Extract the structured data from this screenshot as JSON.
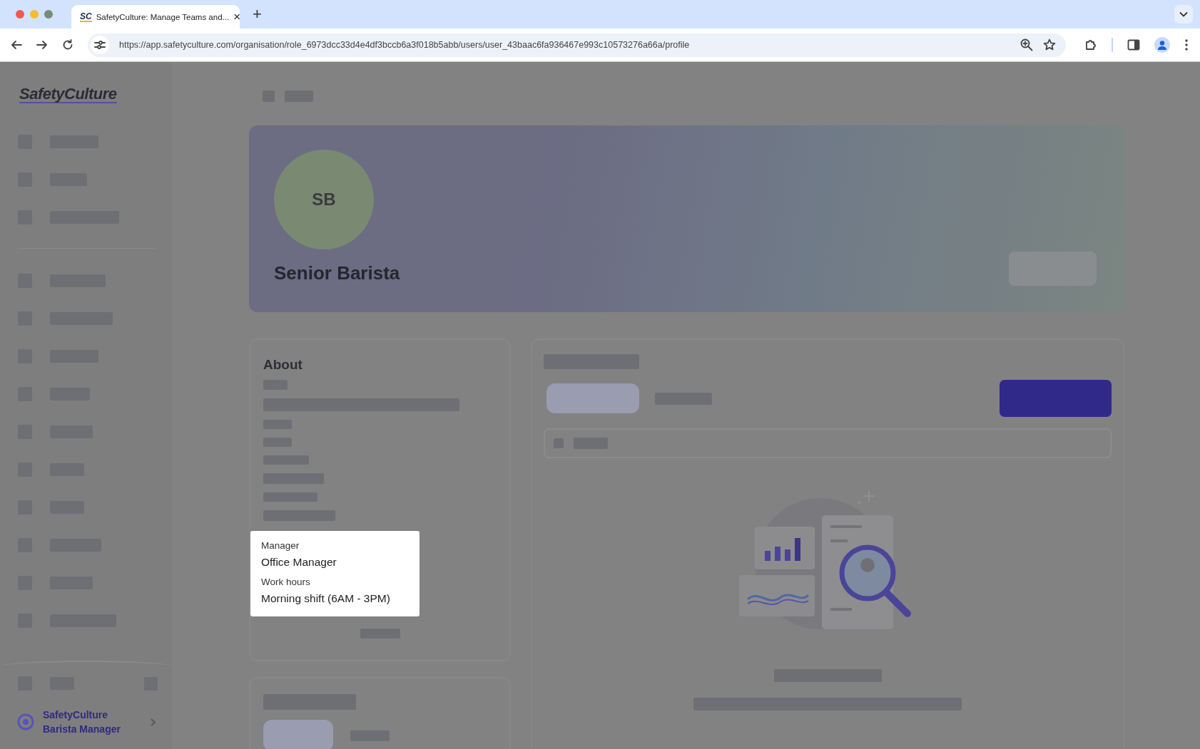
{
  "browser": {
    "tab": {
      "favicon": "SC",
      "title": "SafetyCulture: Manage Teams and...",
      "close": "×"
    },
    "new_tab": "+",
    "url": "https://app.safetyculture.com/organisation/role_6973dcc33d4e4df3bccb6a3f018b5abb/users/user_43baac6fa936467e993c10573276a66a/profile"
  },
  "sidebar": {
    "logo": "SafetyCulture",
    "organization": {
      "line_1": "SafetyCulture",
      "line_2": "Barista Manager"
    }
  },
  "profile": {
    "initials": "SB",
    "title": "Senior Barista"
  },
  "about": {
    "heading": "About",
    "tooltip": [
      {
        "kind": "label",
        "text": "Manager"
      },
      {
        "kind": "value",
        "text": "Office Manager"
      },
      {
        "kind": "label",
        "text": "Work hours"
      },
      {
        "kind": "value",
        "text": "Morning shift (6AM - 3PM)"
      }
    ]
  }
}
